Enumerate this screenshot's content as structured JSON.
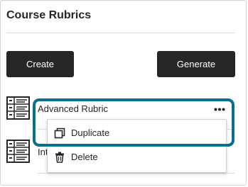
{
  "header": {
    "title": "Course Rubrics"
  },
  "actions": {
    "create_label": "Create",
    "generate_label": "Generate"
  },
  "rubrics": [
    {
      "name": "Advanced Rubric"
    },
    {
      "name": "Int"
    }
  ],
  "context_menu": {
    "items": [
      {
        "label": "Duplicate",
        "icon": "duplicate-icon"
      },
      {
        "label": "Delete",
        "icon": "trash-icon"
      }
    ]
  },
  "colors": {
    "button": "#262626",
    "focus_ring": "#0a6e8c"
  }
}
